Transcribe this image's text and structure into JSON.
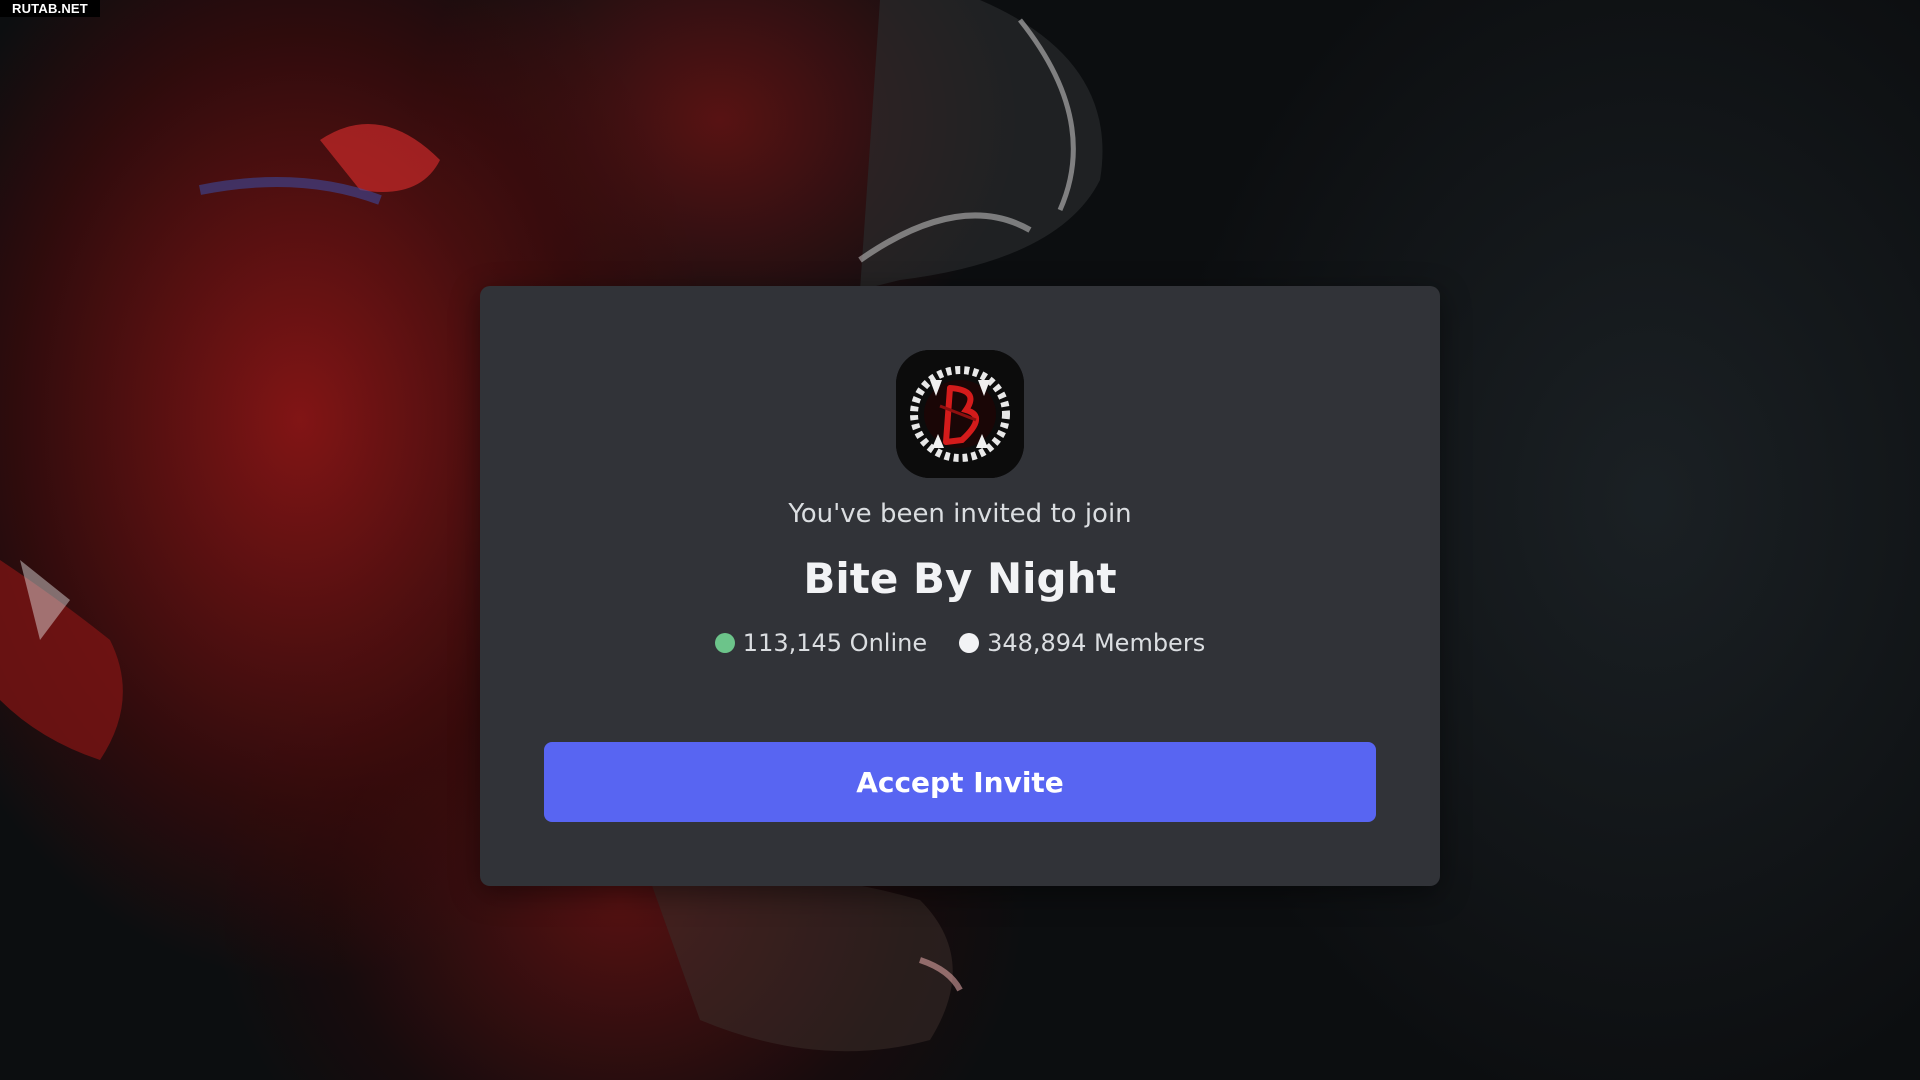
{
  "watermark": {
    "text": "RUTAB.NET"
  },
  "invite": {
    "intro_text": "You've been invited to join",
    "server_name": "Bite By Night",
    "online_count": "113,145 Online",
    "member_count": "348,894 Members",
    "accept_label": "Accept Invite"
  },
  "icons": {
    "server_icon": "server-logo-icon",
    "online_indicator": "online-dot-icon",
    "members_indicator": "members-dot-icon"
  },
  "colors": {
    "card_background": "#313338",
    "accent": "#5865f2",
    "online": "#6cc48a",
    "members": "#f2f3f5",
    "background_red": "#6e1212",
    "background_dark": "#0d1012"
  }
}
